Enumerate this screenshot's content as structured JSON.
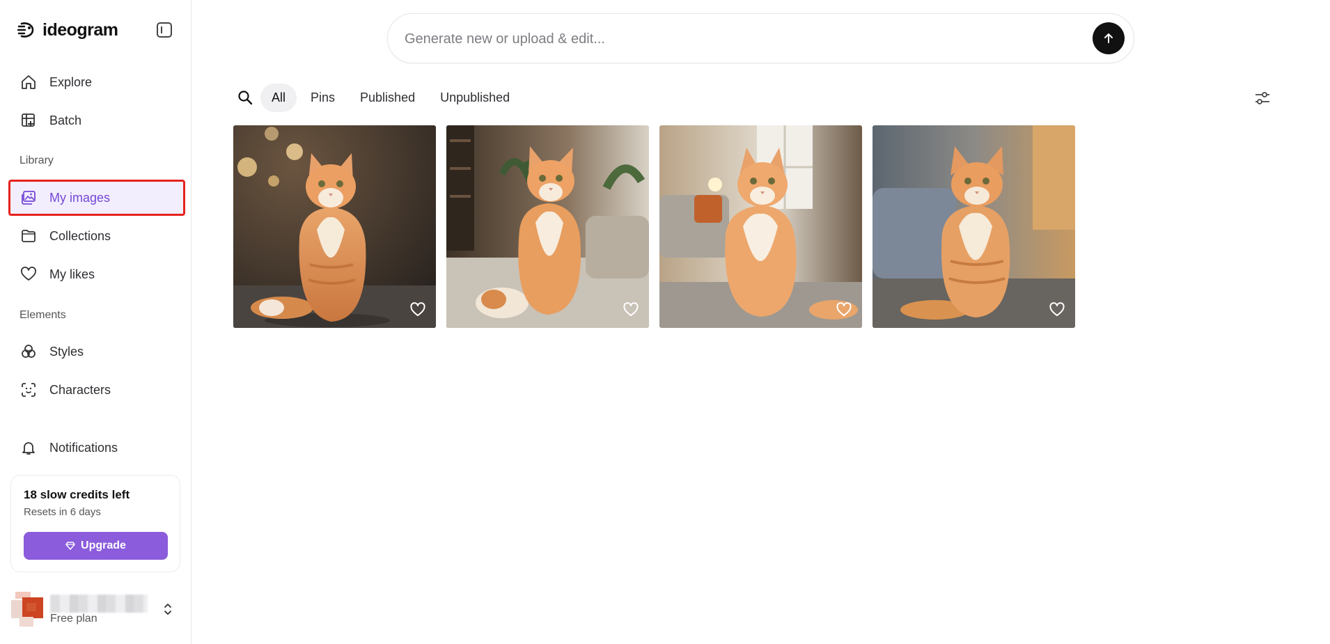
{
  "app": {
    "name": "ideogram"
  },
  "sidebar": {
    "items": [
      {
        "label": "Explore",
        "icon": "home-icon"
      },
      {
        "label": "Batch",
        "icon": "batch-icon"
      }
    ],
    "library_label": "Library",
    "library_items": [
      {
        "label": "My images",
        "icon": "images-icon",
        "active": true
      },
      {
        "label": "Collections",
        "icon": "folder-icon"
      },
      {
        "label": "My likes",
        "icon": "heart-icon"
      }
    ],
    "elements_label": "Elements",
    "elements_items": [
      {
        "label": "Styles",
        "icon": "styles-icon"
      },
      {
        "label": "Characters",
        "icon": "characters-icon"
      }
    ],
    "notifications_label": "Notifications",
    "credits": {
      "title": "18 slow credits left",
      "subtitle": "Resets in 6 days",
      "upgrade_label": "Upgrade"
    },
    "user": {
      "plan": "Free plan"
    }
  },
  "prompt": {
    "placeholder": "Generate new or upload & edit..."
  },
  "filters": {
    "tabs": [
      {
        "label": "All",
        "active": true
      },
      {
        "label": "Pins"
      },
      {
        "label": "Published"
      },
      {
        "label": "Unpublished"
      }
    ]
  },
  "images": [
    {
      "subject": "orange fluffy cat sitting indoors",
      "liked": false
    },
    {
      "subject": "orange fluffy cat sitting on sofa",
      "liked": false
    },
    {
      "subject": "orange fluffy cat sitting in living room",
      "liked": false
    },
    {
      "subject": "orange tabby cat sitting by window",
      "liked": false
    }
  ],
  "colors": {
    "accent": "#8b5cdc",
    "active_text": "#7447d6",
    "highlight_box": "#e5221f"
  }
}
